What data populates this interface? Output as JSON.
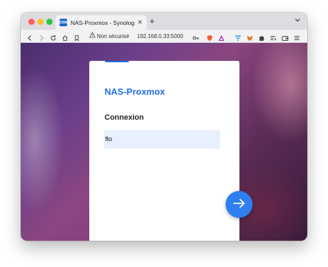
{
  "browser": {
    "tab": {
      "favicon_label": "DSM",
      "title": "NAS-Proxmox - Synology DiskStation"
    },
    "tabs_menu_icon": "chevron-down-icon",
    "address_bar": {
      "security_label": "Non sécurisé",
      "url": "192.168.0.33:5000"
    },
    "toolbar_icons": [
      "back-icon",
      "forward-icon",
      "reload-icon",
      "home-icon",
      "bookmark-icon",
      "key-icon",
      "brave-shield-icon",
      "brave-rewards-icon",
      "filter-icon",
      "metamask-icon",
      "extensions-icon",
      "playlist-icon",
      "wallet-icon",
      "menu-icon"
    ]
  },
  "login": {
    "app_name": "NAS-Proxmox",
    "heading": "Connexion",
    "username_value": "flo",
    "next_icon": "arrow-right-icon"
  },
  "colors": {
    "accent": "#1f6fe0",
    "button": "#2f7ff0",
    "input_bg": "#e8f0fe"
  }
}
